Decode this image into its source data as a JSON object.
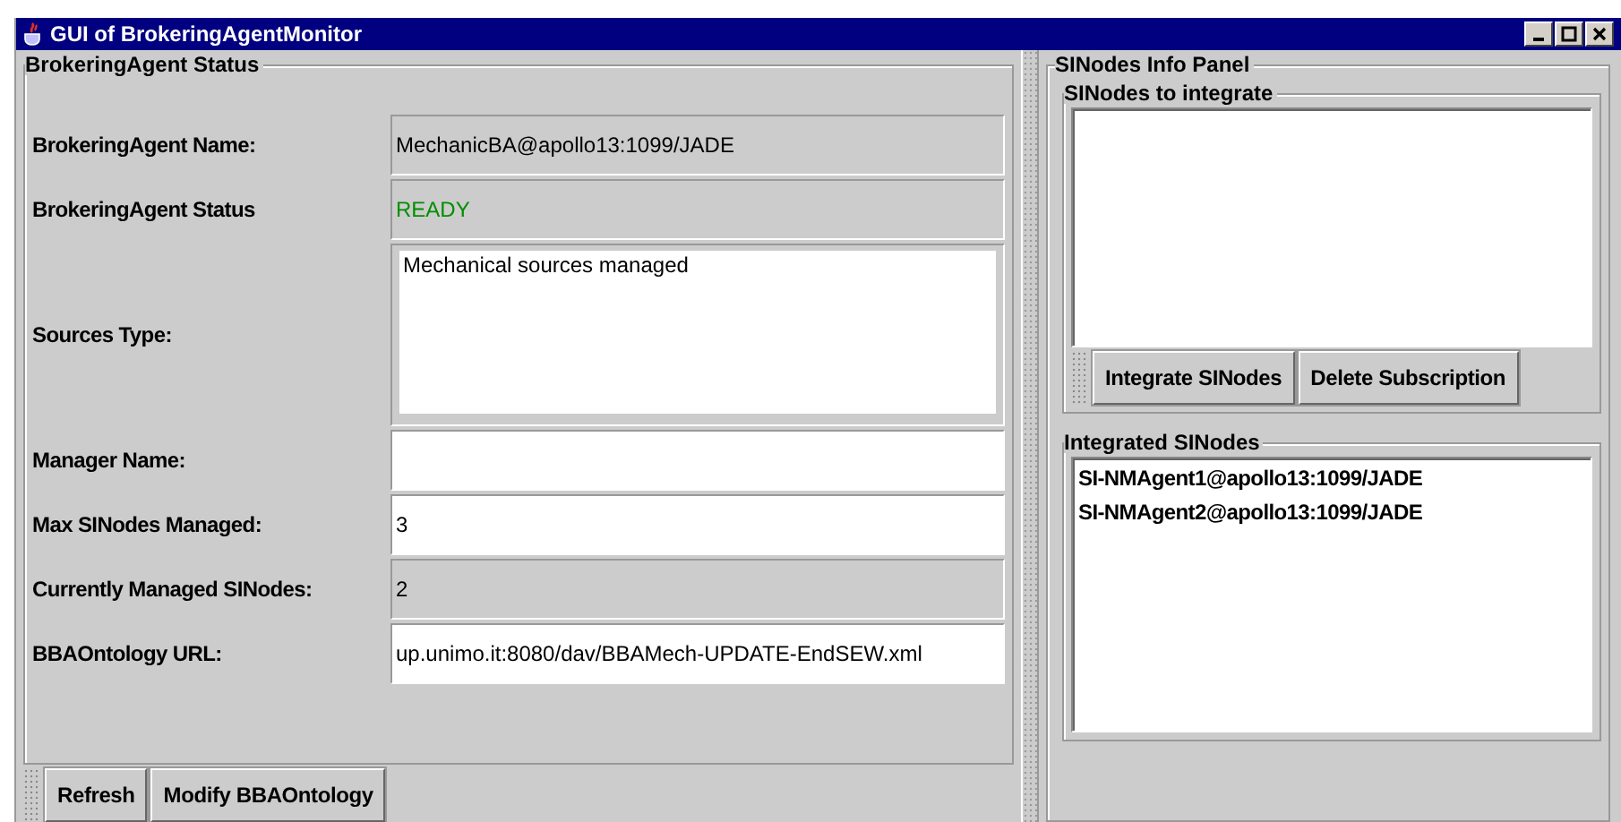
{
  "window": {
    "title": "GUI of BrokeringAgentMonitor"
  },
  "status_panel": {
    "title": "BrokeringAgent Status",
    "fields": [
      {
        "label": "BrokeringAgent Name:",
        "kind": "readonly",
        "value": "MechanicBA@apollo13:1099/JADE"
      },
      {
        "label": "BrokeringAgent Status",
        "kind": "status",
        "value": "READY",
        "color": "#008f00"
      },
      {
        "label": "Sources Type:",
        "kind": "textarea",
        "value": "Mechanical sources managed"
      },
      {
        "label": "Manager Name:",
        "kind": "text"
      },
      {
        "label": "Max SINodes Managed:",
        "kind": "text",
        "value": "3"
      },
      {
        "label": "Currently Managed SINodes:",
        "kind": "readonly",
        "value": "2"
      },
      {
        "label": "BBAOntology URL:",
        "kind": "text",
        "value": "up.unimo.it:8080/dav/BBAMech-UPDATE-EndSEW.xml"
      }
    ],
    "buttons": [
      "Refresh",
      "Modify BBAOntology"
    ]
  },
  "info_panel": {
    "title": "SINodes Info Panel",
    "to_integrate": {
      "title": "SINodes to integrate",
      "buttons": [
        "Integrate SINodes",
        "Delete Subscription"
      ]
    },
    "integrated": {
      "title": "Integrated SINodes",
      "items": [
        "SI-NMAgent1@apollo13:1099/JADE",
        "SI-NMAgent2@apollo13:1099/JADE"
      ]
    }
  }
}
